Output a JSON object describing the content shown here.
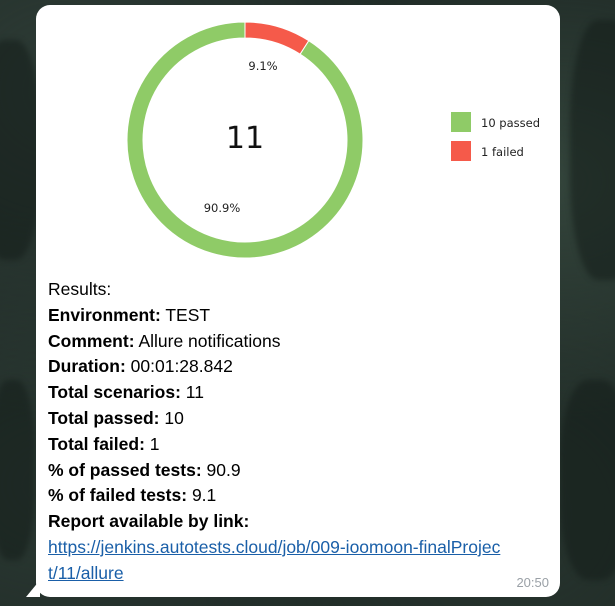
{
  "colors": {
    "passed": "#8fcb67",
    "failed": "#f55a4a",
    "link": "#1a5fa8",
    "timestamp": "#9aa0a6"
  },
  "chart_data": {
    "type": "pie",
    "total_label": "11",
    "slices": [
      {
        "name": "passed",
        "value": 10,
        "percent_label": "90.9%",
        "color": "#8fcb67"
      },
      {
        "name": "failed",
        "value": 1,
        "percent_label": "9.1%",
        "color": "#f55a4a"
      }
    ],
    "legend": [
      {
        "label": "10 passed",
        "color": "#8fcb67"
      },
      {
        "label": "1 failed",
        "color": "#f55a4a"
      }
    ],
    "legend_position": "right"
  },
  "message": {
    "results_heading": "Results:",
    "environment_label": "Environment:",
    "environment_value": "TEST",
    "comment_label": "Comment:",
    "comment_value": "Allure notifications",
    "duration_label": "Duration:",
    "duration_value": "00:01:28.842",
    "total_scenarios_label": "Total scenarios:",
    "total_scenarios_value": "11",
    "total_passed_label": "Total passed:",
    "total_passed_value": "10",
    "total_failed_label": "Total failed:",
    "total_failed_value": "1",
    "passed_pct_label": "% of passed tests:",
    "passed_pct_value": "90.9",
    "failed_pct_label": "% of failed tests:",
    "failed_pct_value": "9.1",
    "report_label": "Report available by link:",
    "report_link": "https://jenkins.autotests.cloud/job/009-ioomoon-finalProject/11/allure",
    "time": "20:50"
  }
}
